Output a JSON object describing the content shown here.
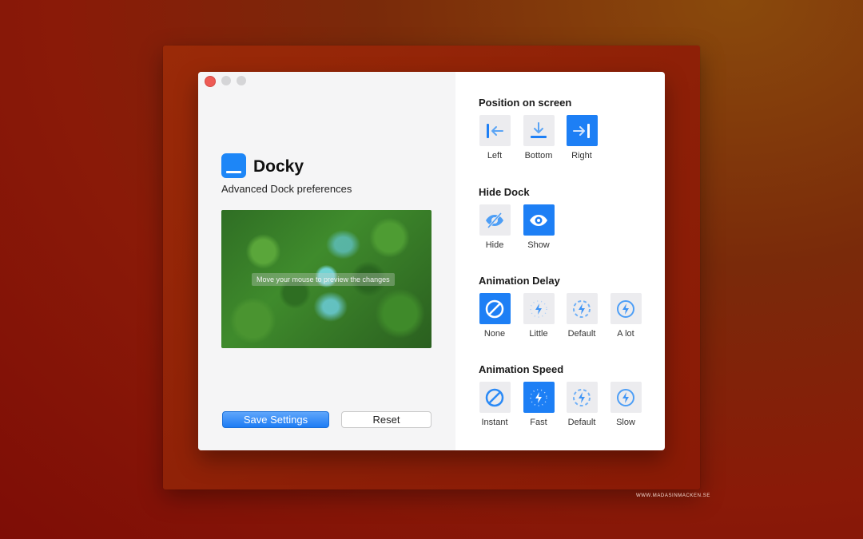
{
  "app": {
    "title": "Docky",
    "subtitle": "Advanced Dock preferences",
    "preview_caption": "Move your mouse to preview the changes"
  },
  "buttons": {
    "save": "Save Settings",
    "reset": "Reset"
  },
  "watermark": "WWW.MADASINMACKEN.SE",
  "sections": {
    "position": {
      "title": "Position on screen",
      "options": [
        {
          "label": "Left",
          "icon": "dock-left-icon",
          "selected": false
        },
        {
          "label": "Bottom",
          "icon": "dock-bottom-icon",
          "selected": false
        },
        {
          "label": "Right",
          "icon": "dock-right-icon",
          "selected": true
        }
      ]
    },
    "hide": {
      "title": "Hide Dock",
      "options": [
        {
          "label": "Hide",
          "icon": "eye-slash-icon",
          "selected": false
        },
        {
          "label": "Show",
          "icon": "eye-icon",
          "selected": true
        }
      ]
    },
    "delay": {
      "title": "Animation Delay",
      "options": [
        {
          "label": "None",
          "icon": "none-icon",
          "selected": true
        },
        {
          "label": "Little",
          "icon": "bolt-dotted-light-icon",
          "selected": false
        },
        {
          "label": "Default",
          "icon": "bolt-dashed-icon",
          "selected": false
        },
        {
          "label": "A lot",
          "icon": "bolt-circle-icon",
          "selected": false
        }
      ]
    },
    "speed": {
      "title": "Animation Speed",
      "options": [
        {
          "label": "Instant",
          "icon": "none-icon",
          "selected": false
        },
        {
          "label": "Fast",
          "icon": "bolt-dotted-light-icon",
          "selected": true
        },
        {
          "label": "Default",
          "icon": "bolt-dashed-icon",
          "selected": false
        },
        {
          "label": "Slow",
          "icon": "bolt-circle-icon",
          "selected": false
        }
      ]
    }
  },
  "colors": {
    "accent": "#1d7ff5",
    "close": "#ee5b55",
    "background": "#8a1a08"
  }
}
